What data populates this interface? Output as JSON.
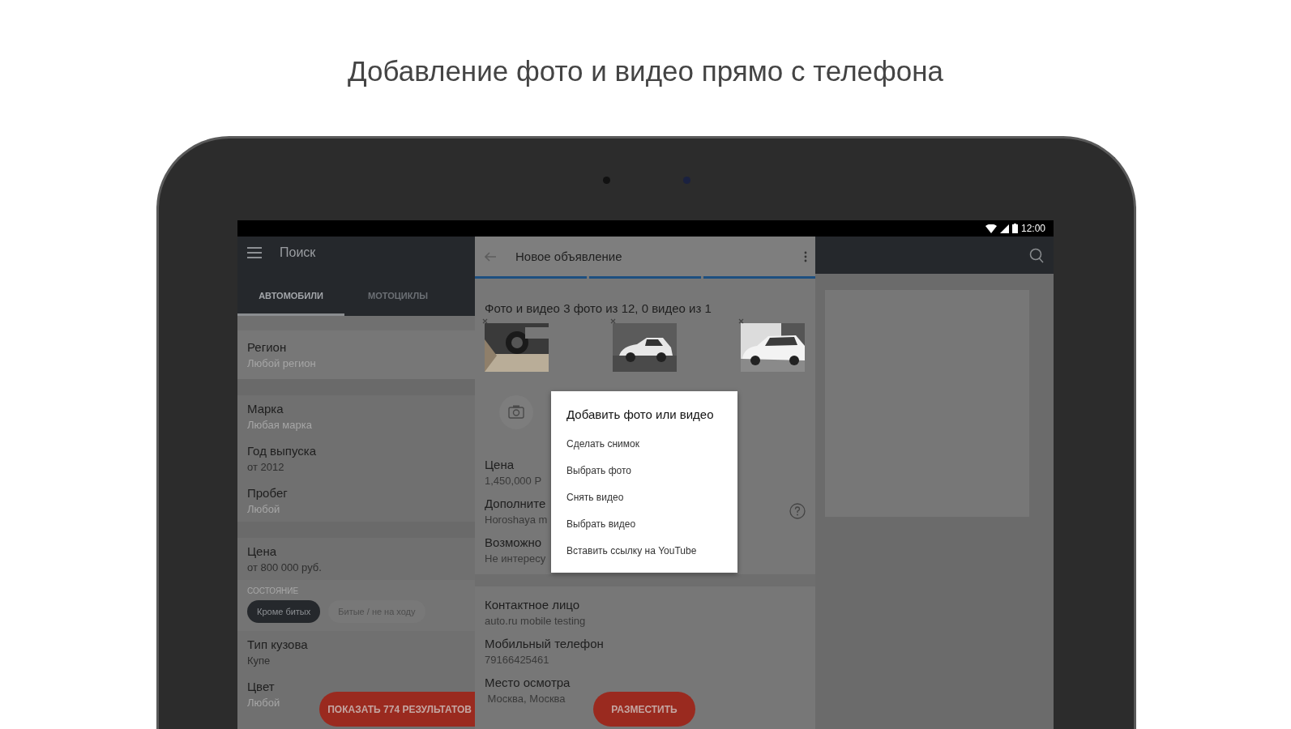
{
  "headline": "Добавление фото и видео прямо с телефона",
  "status_bar": {
    "time": "12:00"
  },
  "search_panel": {
    "title": "Поиск",
    "tabs": [
      {
        "label": "АВТОМОБИЛИ",
        "selected": true
      },
      {
        "label": "МОТОЦИКЛЫ",
        "selected": false
      }
    ],
    "filters": [
      {
        "kind": "field",
        "label": "Регион",
        "value": "Любой регион",
        "set": false,
        "highlighted": true
      },
      {
        "kind": "gap"
      },
      {
        "kind": "field",
        "label": "Марка",
        "value": "Любая марка",
        "set": false,
        "highlighted": false
      },
      {
        "kind": "field",
        "label": "Год выпуска",
        "value": "от 2012",
        "set": true,
        "highlighted": false
      },
      {
        "kind": "field",
        "label": "Пробег",
        "value": "Любой",
        "set": false,
        "highlighted": false
      },
      {
        "kind": "gap"
      },
      {
        "kind": "field",
        "label": "Цена",
        "value": "от 800 000 руб.",
        "set": true,
        "highlighted": false
      },
      {
        "kind": "chips",
        "label": "СОСТОЯНИЕ",
        "chips": [
          {
            "label": "Кроме битых",
            "selected": true
          },
          {
            "label": "Битые / не на ходу",
            "selected": false
          }
        ]
      },
      {
        "kind": "field",
        "label": "Тип кузова",
        "value": "Купе",
        "set": true,
        "highlighted": false
      },
      {
        "kind": "field",
        "label": "Цвет",
        "value": "Любой",
        "set": false,
        "highlighted": false
      }
    ],
    "results_button": "ПОКАЗАТЬ 774 РЕЗУЛЬТАТОВ"
  },
  "listing_form": {
    "title": "Новое объявление",
    "steps": [
      {
        "done": true
      },
      {
        "done": true
      },
      {
        "done": true
      }
    ],
    "photos_title": "Фото и видео 3 фото из 12, 0 видео из 1",
    "fields": [
      {
        "kind": "field",
        "label": "Цена",
        "value": "1,450,000 Р",
        "help": false
      },
      {
        "kind": "field",
        "label": "Дополните",
        "value": "Horoshaya m",
        "help": true
      },
      {
        "kind": "field",
        "label": "Возможно",
        "value": "Не интересу",
        "help": false
      },
      {
        "kind": "gap"
      },
      {
        "kind": "field",
        "label": "Контактное лицо",
        "value": "auto.ru mobile testing",
        "help": false
      },
      {
        "kind": "field",
        "label": "Мобильный телефон",
        "value": "79166425461",
        "help": false
      },
      {
        "kind": "field",
        "label": "Место осмотра",
        "value": " Москва, Москва",
        "help": false
      }
    ],
    "submit_button": "РАЗМЕСТИТЬ"
  },
  "dialog": {
    "title": "Добавить фото или видео",
    "options": [
      "Сделать снимок",
      "Выбрать фото",
      "Снять видео",
      "Выбрать видео",
      "Вставить ссылку на YouTube"
    ]
  }
}
